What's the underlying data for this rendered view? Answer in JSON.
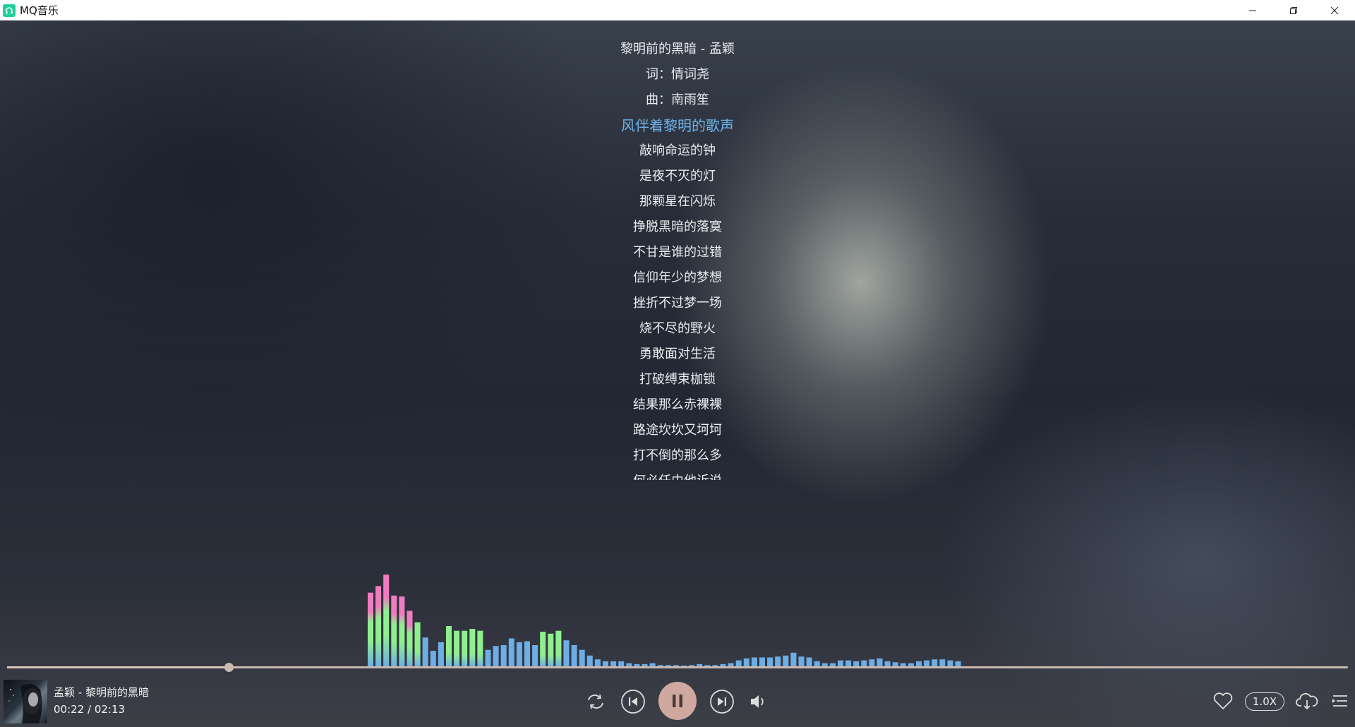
{
  "window": {
    "title": "MQ音乐",
    "logo_color": "#1fcf9a",
    "minimize_icon": "minimize-icon",
    "restore_icon": "restore-icon",
    "close_icon": "close-icon"
  },
  "lyrics": {
    "active_color": "#6fb2e8",
    "lines": [
      {
        "text": "黎明前的黑暗 - 孟颖",
        "active": false
      },
      {
        "text": "词：情词尧",
        "active": false
      },
      {
        "text": "曲：南雨笙",
        "active": false
      },
      {
        "text": "风伴着黎明的歌声",
        "active": true
      },
      {
        "text": "敲响命运的钟",
        "active": false
      },
      {
        "text": "是夜不灭的灯",
        "active": false
      },
      {
        "text": "那颗星在闪烁",
        "active": false
      },
      {
        "text": "挣脱黑暗的落寞",
        "active": false
      },
      {
        "text": "不甘是谁的过错",
        "active": false
      },
      {
        "text": "信仰年少的梦想",
        "active": false
      },
      {
        "text": "挫折不过梦一场",
        "active": false
      },
      {
        "text": "烧不尽的野火",
        "active": false
      },
      {
        "text": "勇敢面对生活",
        "active": false
      },
      {
        "text": "打破缚束枷锁",
        "active": false
      },
      {
        "text": "结果那么赤裸裸",
        "active": false
      },
      {
        "text": "路途坎坎又坷坷",
        "active": false
      },
      {
        "text": "打不倒的那么多",
        "active": false
      },
      {
        "text": "何必任由他诉说",
        "active": false
      }
    ]
  },
  "visualizer": {
    "colors": {
      "pink": "#f07cc0",
      "green": "#8fef8f",
      "blue": "#6eaee6"
    },
    "levels": [
      0.78,
      0.85,
      0.97,
      0.75,
      0.74,
      0.59,
      0.47,
      0.31,
      0.17,
      0.26,
      0.43,
      0.38,
      0.38,
      0.4,
      0.38,
      0.18,
      0.22,
      0.23,
      0.3,
      0.26,
      0.27,
      0.23,
      0.37,
      0.35,
      0.38,
      0.28,
      0.23,
      0.18,
      0.12,
      0.08,
      0.06,
      0.06,
      0.06,
      0.04,
      0.03,
      0.03,
      0.04,
      0.02,
      0.02,
      0.02,
      0.01,
      0.02,
      0.03,
      0.02,
      0.02,
      0.03,
      0.04,
      0.07,
      0.09,
      0.1,
      0.1,
      0.1,
      0.11,
      0.12,
      0.15,
      0.11,
      0.1,
      0.06,
      0.04,
      0.04,
      0.07,
      0.07,
      0.06,
      0.07,
      0.08,
      0.09,
      0.06,
      0.05,
      0.04,
      0.04,
      0.06,
      0.07,
      0.08,
      0.08,
      0.07,
      0.06
    ]
  },
  "player": {
    "song": "孟颖 - 黎明前的黑暗",
    "time": "00:22 / 02:13",
    "current_seconds": 22,
    "total_seconds": 133,
    "progress": 0.165,
    "speed": "1.0X",
    "accent": "#cfa9a0",
    "icons": {
      "repeat": "repeat-icon",
      "prev": "previous-icon",
      "pause": "pause-icon",
      "next": "next-icon",
      "volume": "volume-icon",
      "like": "heart-icon",
      "download": "cloud-download-icon",
      "playlist": "playlist-icon"
    }
  }
}
